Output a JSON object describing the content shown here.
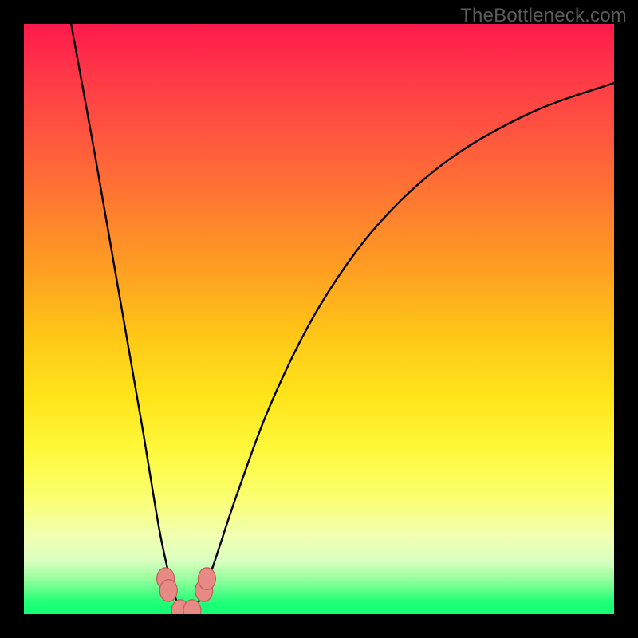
{
  "watermark": "TheBottleneck.com",
  "chart_data": {
    "type": "line",
    "title": "",
    "xlabel": "",
    "ylabel": "",
    "xlim": [
      0,
      100
    ],
    "ylim": [
      0,
      100
    ],
    "grid": false,
    "curve": {
      "description": "V-shaped bottleneck curve touching near zero around x≈25-30 and rising steeply to both sides",
      "x": [
        8,
        12,
        16,
        20,
        23,
        25,
        26,
        27,
        28,
        29,
        30,
        32,
        36,
        42,
        50,
        60,
        72,
        86,
        100
      ],
      "y": [
        100,
        78,
        55,
        32,
        14,
        5,
        2,
        0.5,
        0.5,
        1,
        3,
        8,
        20,
        36,
        52,
        66,
        77,
        85,
        90
      ]
    },
    "markers": [
      {
        "x": 24.0,
        "y": 6.0,
        "color": "#e78a86"
      },
      {
        "x": 24.5,
        "y": 4.0,
        "color": "#e78a86"
      },
      {
        "x": 26.5,
        "y": 0.6,
        "color": "#e78a86"
      },
      {
        "x": 28.5,
        "y": 0.6,
        "color": "#e78a86"
      },
      {
        "x": 30.5,
        "y": 4.0,
        "color": "#e78a86"
      },
      {
        "x": 31.0,
        "y": 6.0,
        "color": "#e78a86"
      }
    ],
    "marker_style": {
      "r": 11,
      "stroke": "#c25a56",
      "stroke_width": 1.2
    }
  }
}
